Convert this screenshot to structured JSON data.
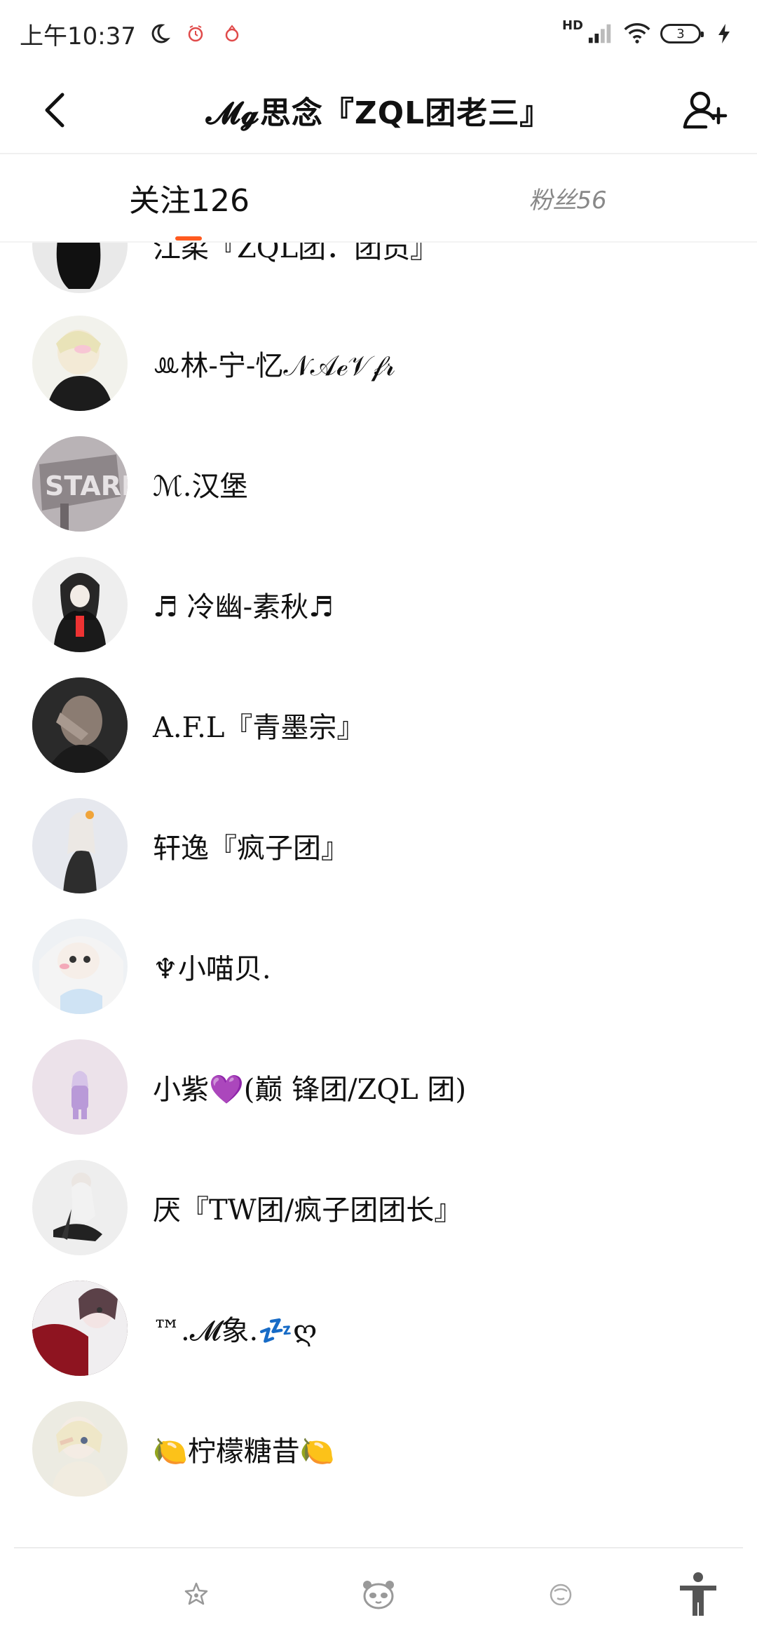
{
  "status": {
    "time": "上午10:37",
    "network": "HD",
    "battery": "3"
  },
  "header": {
    "title": "𝓜𝓰思念『ZQL团老三』"
  },
  "tabs": {
    "following": "关注126",
    "followers": "粉丝56"
  },
  "list": {
    "items": [
      {
        "name": "江柔『ZQL团．团员』",
        "avatar": "dark-hair-girl"
      },
      {
        "name": "ꔛ林-宁-忆𝒩𝒜ℯ𝒱𝒻𝓇",
        "avatar": "blonde-figure"
      },
      {
        "name": "ℳ.汉堡",
        "avatar": "stark-sign"
      },
      {
        "name": "♬ 冷幽-素秋♬",
        "avatar": "uniform-girl"
      },
      {
        "name": "A.F.L『青墨宗』",
        "avatar": "face-cover"
      },
      {
        "name": "轩逸『疯子团』",
        "avatar": "white-hair-figure"
      },
      {
        "name": "♆小喵贝.",
        "avatar": "blush-girl"
      },
      {
        "name": "小紫💜(巅 锋团/ZQL 团)",
        "avatar": "purple-figure"
      },
      {
        "name": "厌『TW团/疯子团团长』",
        "avatar": "sitting-figure"
      },
      {
        "name": "™.𝓜象.💤ღ",
        "avatar": "red-dress-girl"
      },
      {
        "name": "🍋柠檬糖昔🍋",
        "avatar": "cream-girl"
      }
    ]
  },
  "colors": {
    "accent": "#ff5a1f",
    "tab_inactive": "#888888"
  },
  "bottom_nav": {
    "icons": [
      "flower-icon",
      "panda-icon",
      "sticker-icon",
      "accessibility-icon"
    ]
  }
}
